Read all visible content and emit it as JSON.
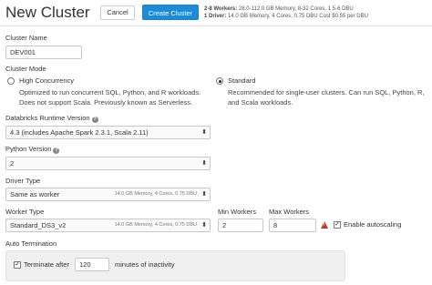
{
  "header": {
    "title": "New Cluster",
    "cancel_label": "Cancel",
    "create_label": "Create Cluster",
    "summary_line1_prefix": "2-8 Workers:",
    "summary_line1": " 28.0-112.0 GB Memory, 8-32 Cores, 1.5-6 DBU",
    "summary_line2_prefix": "1 Driver:",
    "summary_line2": " 14.0 GB Memory, 4 Cores, 0.75 DBU Cost $0.55 per DBU"
  },
  "cluster_name": {
    "label": "Cluster Name",
    "value": "DEV001"
  },
  "cluster_mode": {
    "label": "Cluster Mode",
    "options": [
      {
        "label": "High Concurrency",
        "selected": false,
        "desc1": "Optimized to run concurrent SQL, Python, and R workloads.",
        "desc2": "Does not support Scala. Previously known as Serverless."
      },
      {
        "label": "Standard",
        "selected": true,
        "desc1": "Recommended for single-user clusters. Can run SQL, Python, R,",
        "desc2": "and Scala workloads."
      }
    ]
  },
  "runtime": {
    "label": "Databricks Runtime Version",
    "value": "4.3 (includes Apache Spark 2.3.1, Scala 2.11)",
    "help_icon": "question-circle-icon"
  },
  "python": {
    "label": "Python Version",
    "value": "2",
    "help_icon": "question-circle-icon"
  },
  "driver": {
    "label": "Driver Type",
    "value": "Same as worker",
    "spec": "14.0 GB Memory, 4 Cores, 0.75 DBU"
  },
  "worker": {
    "label": "Worker Type",
    "value": "Standard_DS3_v2",
    "spec": "14.0 GB Memory, 4 Cores, 0.75 DBU"
  },
  "min_workers": {
    "label": "Min Workers",
    "value": "2"
  },
  "max_workers": {
    "label": "Max Workers",
    "value": "8"
  },
  "autoscaling": {
    "label": "Enable autoscaling",
    "checked": true,
    "warning_icon": "warning-triangle-icon"
  },
  "auto_termination": {
    "label": "Auto Termination",
    "checkbox_label": "Terminate after",
    "checked": true,
    "minutes": "120",
    "suffix": "minutes of inactivity"
  },
  "colors": {
    "primary": "#1f8ad6",
    "warning": "#c0392b"
  }
}
